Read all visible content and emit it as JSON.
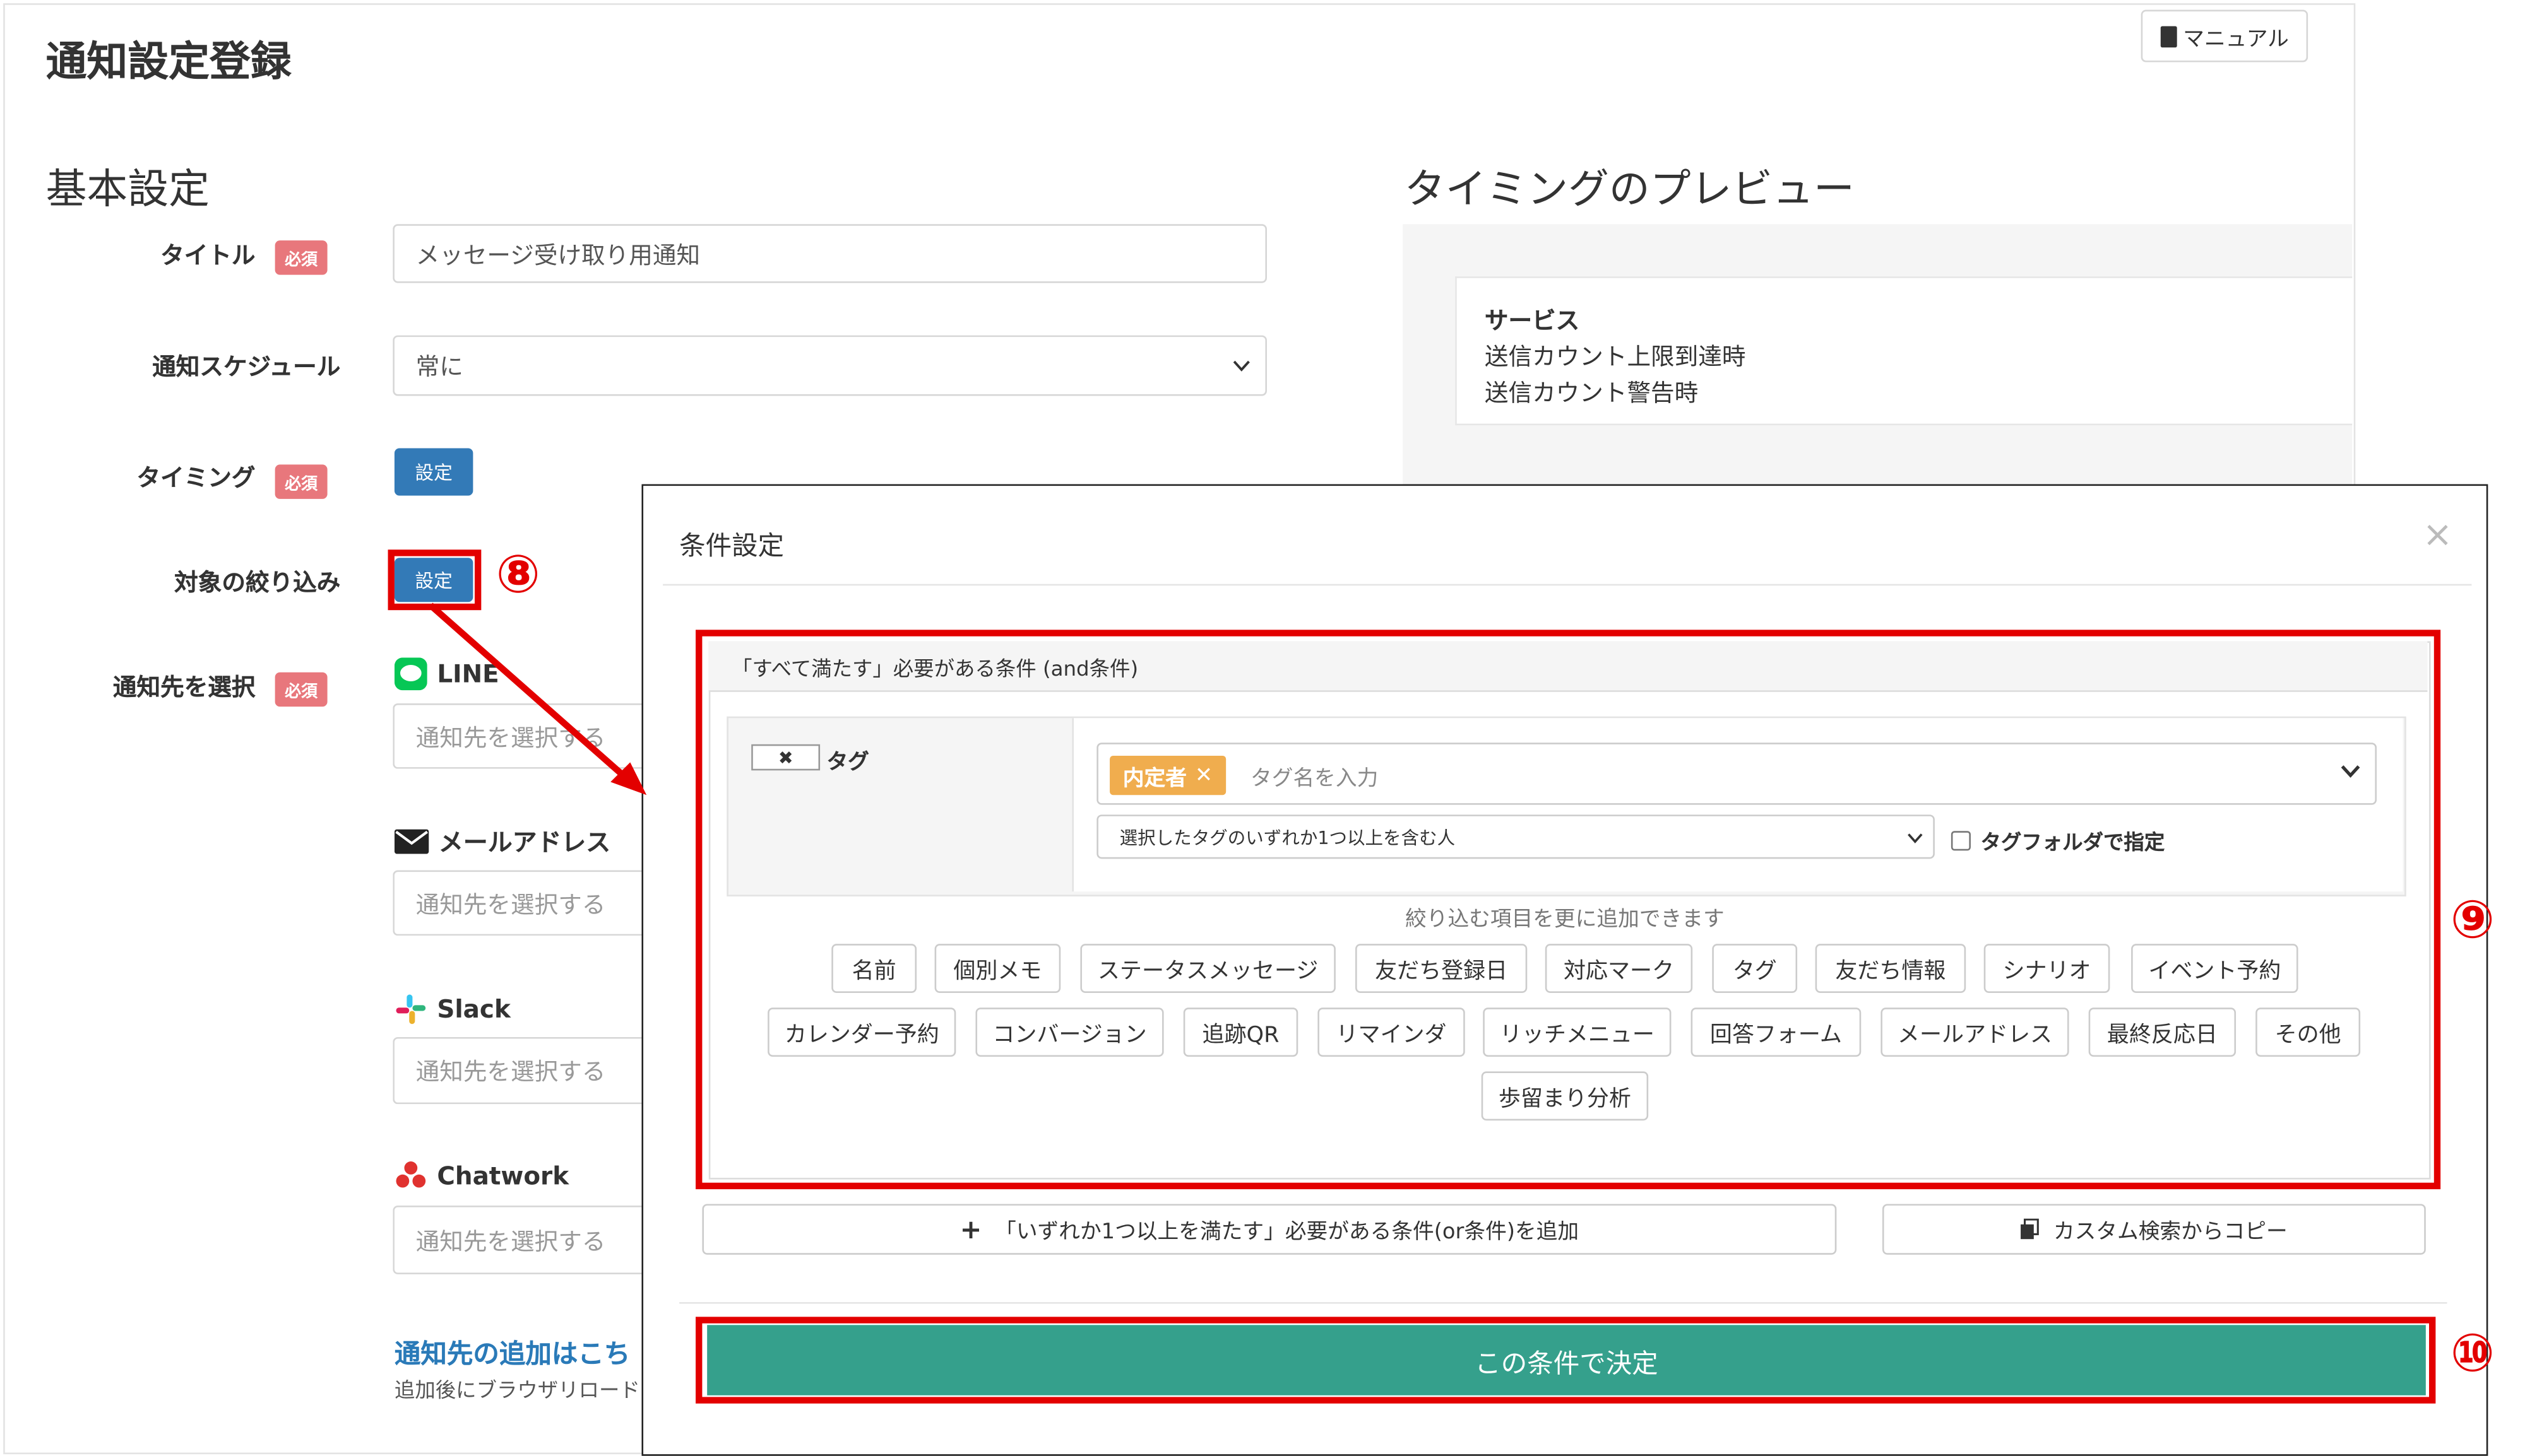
{
  "page": {
    "title": "通知設定登録",
    "manual_button": "マニュアル"
  },
  "basic": {
    "heading": "基本設定",
    "required_badge": "必須",
    "title_label": "タイトル",
    "title_value": "メッセージ受け取り用通知",
    "schedule_label": "通知スケジュール",
    "schedule_value": "常に",
    "timing_label": "タイミング",
    "timing_button": "設定",
    "filter_label": "対象の絞り込み",
    "filter_button": "設定",
    "destination_label": "通知先を選択",
    "channels": [
      {
        "name": "LINE",
        "placeholder": "通知先を選択する"
      },
      {
        "name": "メールアドレス",
        "placeholder": "通知先を選択する"
      },
      {
        "name": "Slack",
        "placeholder": "通知先を選択する"
      },
      {
        "name": "Chatwork",
        "placeholder": "通知先を選択する"
      }
    ],
    "add_destination_link": "通知先の追加はこち",
    "reload_note": "追加後にブラウザリロード"
  },
  "preview": {
    "heading": "タイミングのプレビュー",
    "service_title": "サービス",
    "lines": [
      "送信カウント上限到達時",
      "送信カウント警告時"
    ]
  },
  "modal": {
    "title": "条件設定",
    "close": "×",
    "and_header": "「すべて満たす」必要がある条件 (and条件)",
    "condition": {
      "remove_label": "✖",
      "field": "タグ",
      "selected_tag": "内定者",
      "tag_placeholder": "タグ名を入力",
      "match_mode": "選択したタグのいずれか1つ以上を含む人",
      "folder_checkbox": "タグフォルダで指定"
    },
    "hint": "絞り込む項目を更に追加できます",
    "items": [
      "名前",
      "個別メモ",
      "ステータスメッセージ",
      "友だち登録日",
      "対応マーク",
      "タグ",
      "友だち情報",
      "シナリオ",
      "イベント予約",
      "カレンダー予約",
      "コンバージョン",
      "追跡QR",
      "リマインダ",
      "リッチメニュー",
      "回答フォーム",
      "メールアドレス",
      "最終反応日",
      "その他",
      "歩留まり分析"
    ],
    "add_or_button": "「いずれか1つ以上を満たす」必要がある条件(or条件)を追加",
    "copy_button": "カスタム検索からコピー",
    "decide_button": "この条件で決定"
  },
  "annotations": {
    "step8": "⑧",
    "step9": "⑨",
    "step10": "⑩",
    "color": "#e30000"
  },
  "colors": {
    "primary": "#337ab7",
    "decide": "#35a08c",
    "badge": "#e8777c",
    "tag_chip": "#f0ad4e",
    "link": "#2a7ab8"
  }
}
